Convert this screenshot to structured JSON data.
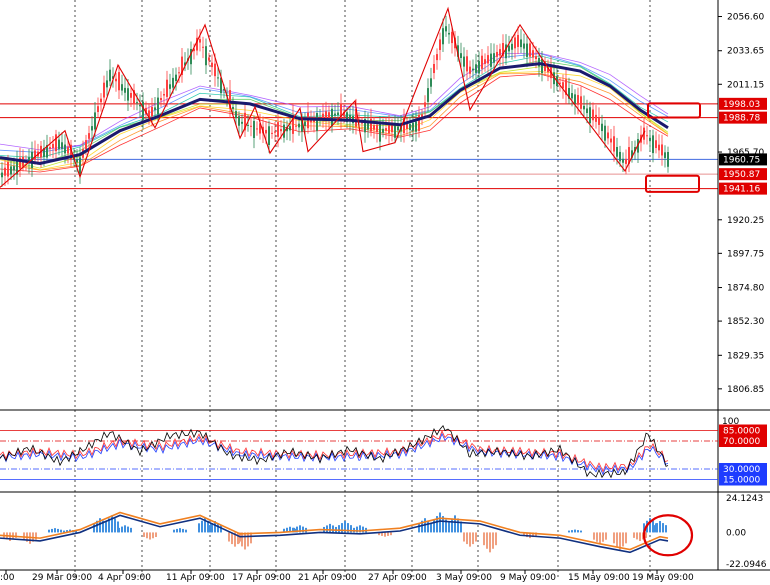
{
  "chart_data": {
    "type": "line",
    "main": {
      "price_ticks": [
        "2056.60",
        "2033.65",
        "2011.15",
        "1965.70",
        "1920.25",
        "1897.75",
        "1874.80",
        "1852.30",
        "1829.35",
        "1806.85"
      ],
      "price_tick_values": [
        2056.6,
        2033.65,
        2011.15,
        1965.7,
        1920.25,
        1897.75,
        1874.8,
        1852.3,
        1829.35,
        1806.85
      ],
      "ylim": [
        1794,
        2065
      ],
      "level_tags": [
        {
          "label": "1998.03",
          "value": 1998.03,
          "color": "#e00000"
        },
        {
          "label": "1988.78",
          "value": 1988.78,
          "color": "#e00000"
        },
        {
          "label": "1960.75",
          "value": 1960.75,
          "color": "#000000"
        },
        {
          "label": "1950.87",
          "value": 1950.87,
          "color": "#e00000"
        },
        {
          "label": "1941.16",
          "value": 1941.16,
          "color": "#e00000"
        }
      ],
      "hlines": [
        {
          "value": 1998.03,
          "color": "#e00000"
        },
        {
          "value": 1988.78,
          "color": "#e00000"
        },
        {
          "value": 1960.75,
          "color": "#4169e1"
        },
        {
          "value": 1950.87,
          "color": "#e89090"
        },
        {
          "value": 1941.16,
          "color": "#e00000"
        }
      ],
      "zigzag": [
        [
          0,
          1942
        ],
        [
          65,
          1980
        ],
        [
          80,
          1949
        ],
        [
          118,
          2024
        ],
        [
          155,
          1982
        ],
        [
          205,
          2051
        ],
        [
          240,
          1975
        ],
        [
          255,
          1996
        ],
        [
          270,
          1965
        ],
        [
          300,
          1995
        ],
        [
          308,
          1966
        ],
        [
          355,
          2000
        ],
        [
          363,
          1966
        ],
        [
          395,
          1972
        ],
        [
          448,
          2062
        ],
        [
          470,
          1994
        ],
        [
          520,
          2051
        ],
        [
          555,
          2015
        ],
        [
          625,
          1953
        ],
        [
          645,
          1980
        ]
      ],
      "ma_main": [
        [
          0,
          1962
        ],
        [
          40,
          1958
        ],
        [
          80,
          1964
        ],
        [
          120,
          1980
        ],
        [
          160,
          1990
        ],
        [
          200,
          2001
        ],
        [
          250,
          1998
        ],
        [
          300,
          1988
        ],
        [
          350,
          1987
        ],
        [
          400,
          1984
        ],
        [
          430,
          1990
        ],
        [
          460,
          2007
        ],
        [
          500,
          2022
        ],
        [
          540,
          2025
        ],
        [
          580,
          2020
        ],
        [
          610,
          2010
        ],
        [
          640,
          1994
        ],
        [
          668,
          1982
        ]
      ],
      "candles": [
        [
          0,
          1950
        ],
        [
          60,
          1972
        ],
        [
          80,
          1958
        ],
        [
          110,
          2018
        ],
        [
          150,
          1990
        ],
        [
          200,
          2040
        ],
        [
          240,
          1986
        ],
        [
          270,
          1978
        ],
        [
          300,
          1984
        ],
        [
          340,
          1992
        ],
        [
          380,
          1980
        ],
        [
          420,
          1984
        ],
        [
          445,
          2050
        ],
        [
          470,
          2020
        ],
        [
          520,
          2040
        ],
        [
          560,
          2012
        ],
        [
          600,
          1985
        ],
        [
          625,
          1958
        ],
        [
          645,
          1978
        ],
        [
          668,
          1962
        ]
      ],
      "rects": [
        {
          "x1": 1998.3,
          "x2": 1988.9,
          "left": 648,
          "right": 700
        },
        {
          "x1": 1949.8,
          "x2": 1939.0,
          "left": 646,
          "right": 699
        }
      ]
    },
    "rsi": {
      "top_label": "100",
      "ylim": [
        0,
        110
      ],
      "level_tags": [
        {
          "label": "85.0000",
          "value": 85,
          "color": "#e00000"
        },
        {
          "label": "70.0000",
          "value": 70,
          "color": "#e00000"
        },
        {
          "label": "30.0000",
          "value": 30,
          "color": "#1e3cff"
        },
        {
          "label": "15.0000",
          "value": 15,
          "color": "#1e3cff"
        }
      ],
      "line1": [
        [
          0,
          45
        ],
        [
          30,
          60
        ],
        [
          60,
          40
        ],
        [
          80,
          55
        ],
        [
          110,
          82
        ],
        [
          140,
          55
        ],
        [
          170,
          78
        ],
        [
          200,
          82
        ],
        [
          230,
          50
        ],
        [
          260,
          42
        ],
        [
          290,
          55
        ],
        [
          320,
          45
        ],
        [
          350,
          58
        ],
        [
          380,
          44
        ],
        [
          410,
          62
        ],
        [
          445,
          90
        ],
        [
          470,
          52
        ],
        [
          500,
          55
        ],
        [
          530,
          48
        ],
        [
          560,
          58
        ],
        [
          590,
          22
        ],
        [
          625,
          25
        ],
        [
          648,
          80
        ],
        [
          668,
          35
        ]
      ],
      "line2": [
        [
          0,
          50
        ],
        [
          40,
          55
        ],
        [
          80,
          50
        ],
        [
          120,
          70
        ],
        [
          160,
          62
        ],
        [
          200,
          75
        ],
        [
          240,
          55
        ],
        [
          280,
          52
        ],
        [
          320,
          50
        ],
        [
          360,
          52
        ],
        [
          400,
          55
        ],
        [
          445,
          80
        ],
        [
          480,
          58
        ],
        [
          520,
          55
        ],
        [
          560,
          52
        ],
        [
          600,
          32
        ],
        [
          630,
          35
        ],
        [
          650,
          65
        ],
        [
          668,
          42
        ]
      ]
    },
    "macd": {
      "ticks": [
        "24.1243",
        "0.00",
        "-22.0946"
      ],
      "ylim": [
        -25,
        27
      ],
      "line": [
        [
          0,
          -4
        ],
        [
          40,
          -6
        ],
        [
          80,
          0
        ],
        [
          120,
          12
        ],
        [
          160,
          4
        ],
        [
          200,
          10
        ],
        [
          240,
          -3
        ],
        [
          280,
          -2
        ],
        [
          320,
          0
        ],
        [
          360,
          -1
        ],
        [
          400,
          1
        ],
        [
          440,
          8
        ],
        [
          480,
          6
        ],
        [
          520,
          -2
        ],
        [
          560,
          -4
        ],
        [
          600,
          -10
        ],
        [
          630,
          -14
        ],
        [
          660,
          -5
        ],
        [
          668,
          -6
        ]
      ],
      "hist": [
        [
          10,
          -6
        ],
        [
          30,
          -8
        ],
        [
          55,
          3
        ],
        [
          70,
          2
        ],
        [
          100,
          10
        ],
        [
          112,
          12
        ],
        [
          125,
          5
        ],
        [
          150,
          -5
        ],
        [
          180,
          3
        ],
        [
          205,
          10
        ],
        [
          215,
          8
        ],
        [
          235,
          -10
        ],
        [
          245,
          -12
        ],
        [
          290,
          4
        ],
        [
          300,
          5
        ],
        [
          330,
          6
        ],
        [
          345,
          8
        ],
        [
          360,
          5
        ],
        [
          385,
          -3
        ],
        [
          425,
          10
        ],
        [
          440,
          14
        ],
        [
          455,
          12
        ],
        [
          470,
          -10
        ],
        [
          490,
          -14
        ],
        [
          530,
          -4
        ],
        [
          575,
          2
        ],
        [
          600,
          -8
        ],
        [
          620,
          -12
        ],
        [
          640,
          -6
        ],
        [
          650,
          10
        ],
        [
          660,
          8
        ]
      ],
      "circle_center": [
        668,
        -2
      ]
    },
    "x_labels": [
      ":00",
      "29 Mar 09:00",
      "4 Apr 09:00",
      "11 Apr 09:00",
      "17 Apr 09:00",
      "21 Apr 09:00",
      "27 Apr 09:00",
      "3 May 09:00",
      "9 May 09:00",
      "15 May 09:00",
      "19 May 09:00"
    ],
    "colors": {
      "up": "#2e8b57",
      "down": "#ff4040",
      "accent": "#e00000",
      "ma": "#1a1a6e",
      "grid": "#000000"
    }
  }
}
